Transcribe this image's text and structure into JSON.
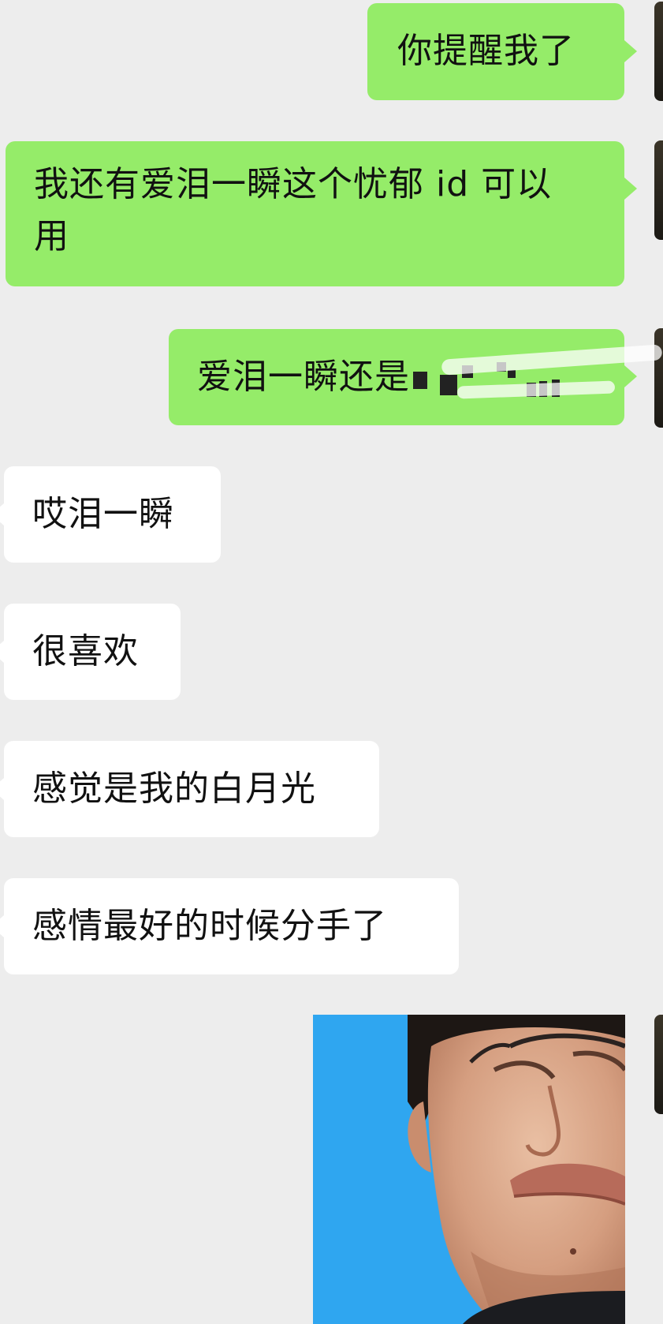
{
  "messages": [
    {
      "id": "m1",
      "side": "sent",
      "text": "你提醒我了"
    },
    {
      "id": "m2",
      "side": "sent",
      "text_line1": "我还有爱泪一瞬这个忧郁 id 可以",
      "text_line2": "用"
    },
    {
      "id": "m3",
      "side": "sent",
      "text": "爱泪一瞬还是"
    },
    {
      "id": "m4",
      "side": "received",
      "text": "哎泪一瞬"
    },
    {
      "id": "m5",
      "side": "received",
      "text": "很喜欢"
    },
    {
      "id": "m6",
      "side": "received",
      "text": "感觉是我的白月光"
    },
    {
      "id": "m7",
      "side": "received",
      "text": "感情最好的时候分手了"
    },
    {
      "id": "m8",
      "side": "sent",
      "type": "sticker",
      "sticker": "crying-man-sticker"
    }
  ],
  "colors": {
    "background": "#ededed",
    "sent_bubble": "#95ec69",
    "received_bubble": "#ffffff",
    "sticker_background": "#2fa6f0"
  }
}
